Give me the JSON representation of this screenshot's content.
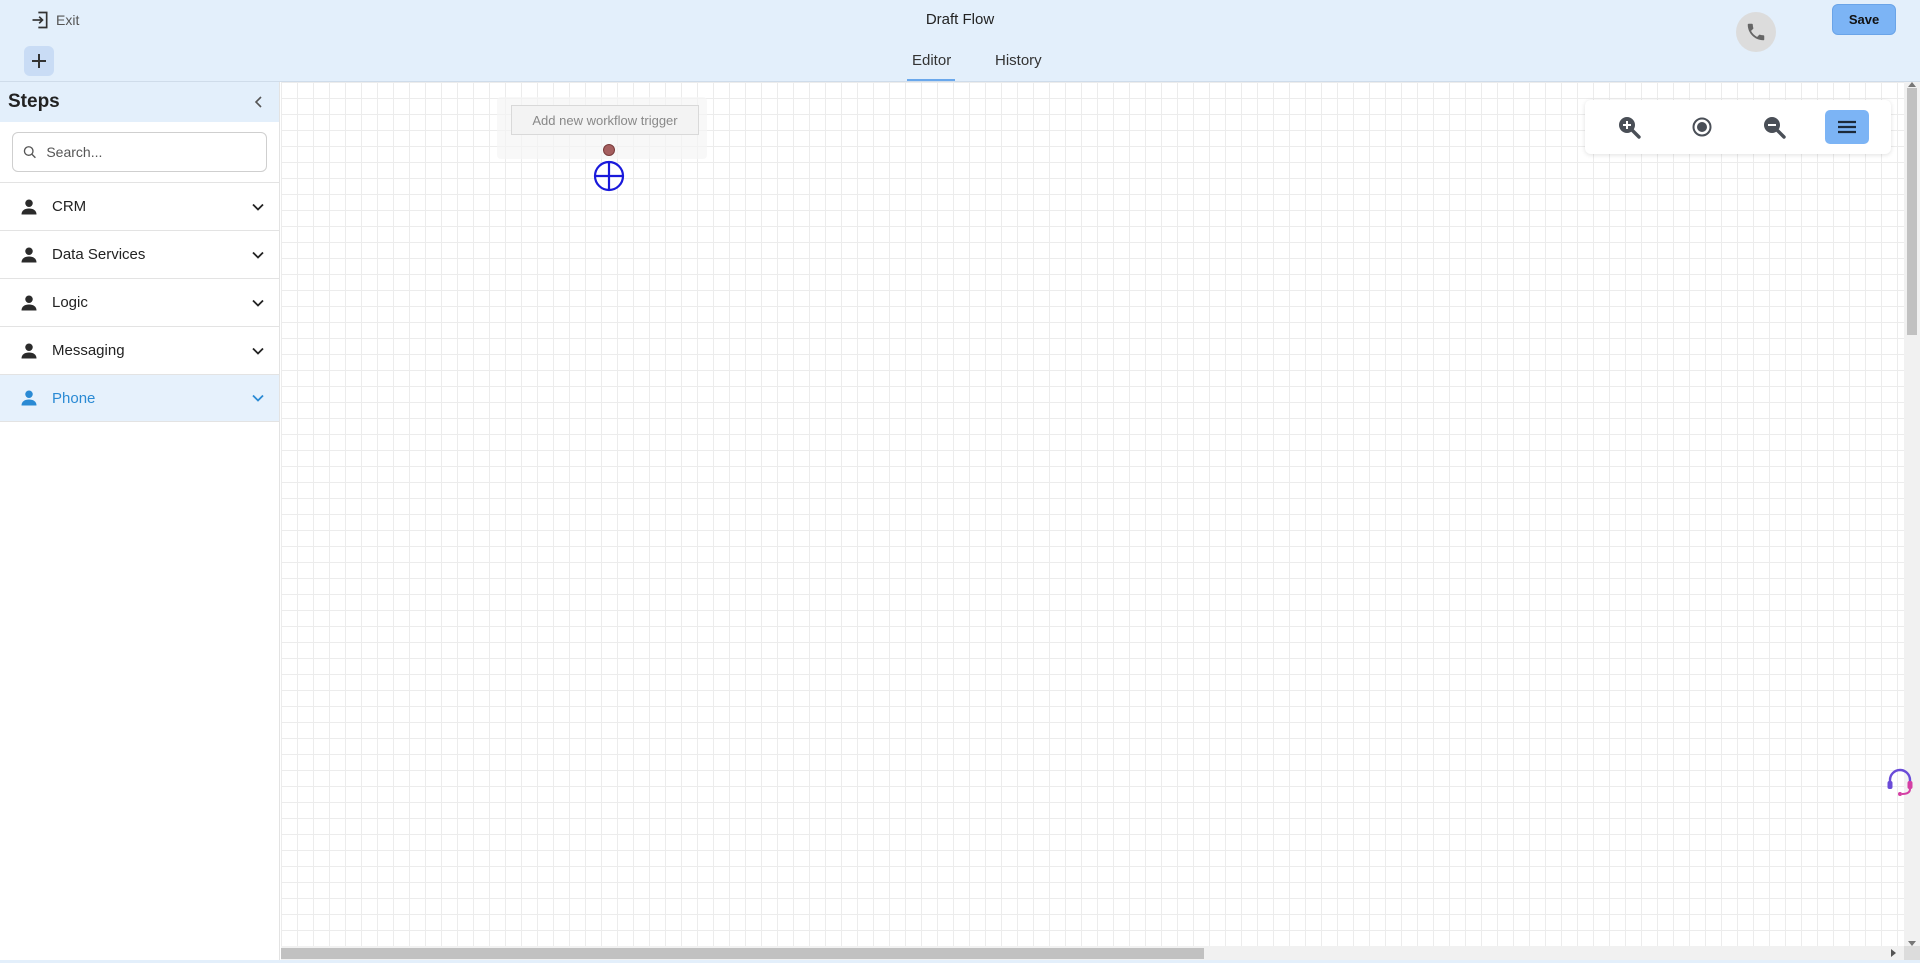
{
  "header": {
    "exit_label": "Exit",
    "title": "Draft Flow",
    "save_label": "Save"
  },
  "tabs": [
    {
      "label": "Editor",
      "active": true
    },
    {
      "label": "History",
      "active": false
    }
  ],
  "sidebar": {
    "title": "Steps",
    "search_placeholder": "Search...",
    "categories": [
      {
        "label": "CRM",
        "icon": "person-icon",
        "active": false
      },
      {
        "label": "Data Services",
        "icon": "person-icon",
        "active": false
      },
      {
        "label": "Logic",
        "icon": "person-icon",
        "active": false
      },
      {
        "label": "Messaging",
        "icon": "person-icon",
        "active": false
      },
      {
        "label": "Phone",
        "icon": "person-icon",
        "active": true
      }
    ]
  },
  "canvas": {
    "trigger_label": "Add new workflow trigger"
  },
  "zoom_controls": [
    "zoom-in-icon",
    "center-icon",
    "zoom-out-icon",
    "menu-icon"
  ],
  "colors": {
    "header_bg": "#e3effb",
    "accent": "#7cb4f5",
    "active_text": "#2a8ad4",
    "add_node": "#1a1adb"
  }
}
